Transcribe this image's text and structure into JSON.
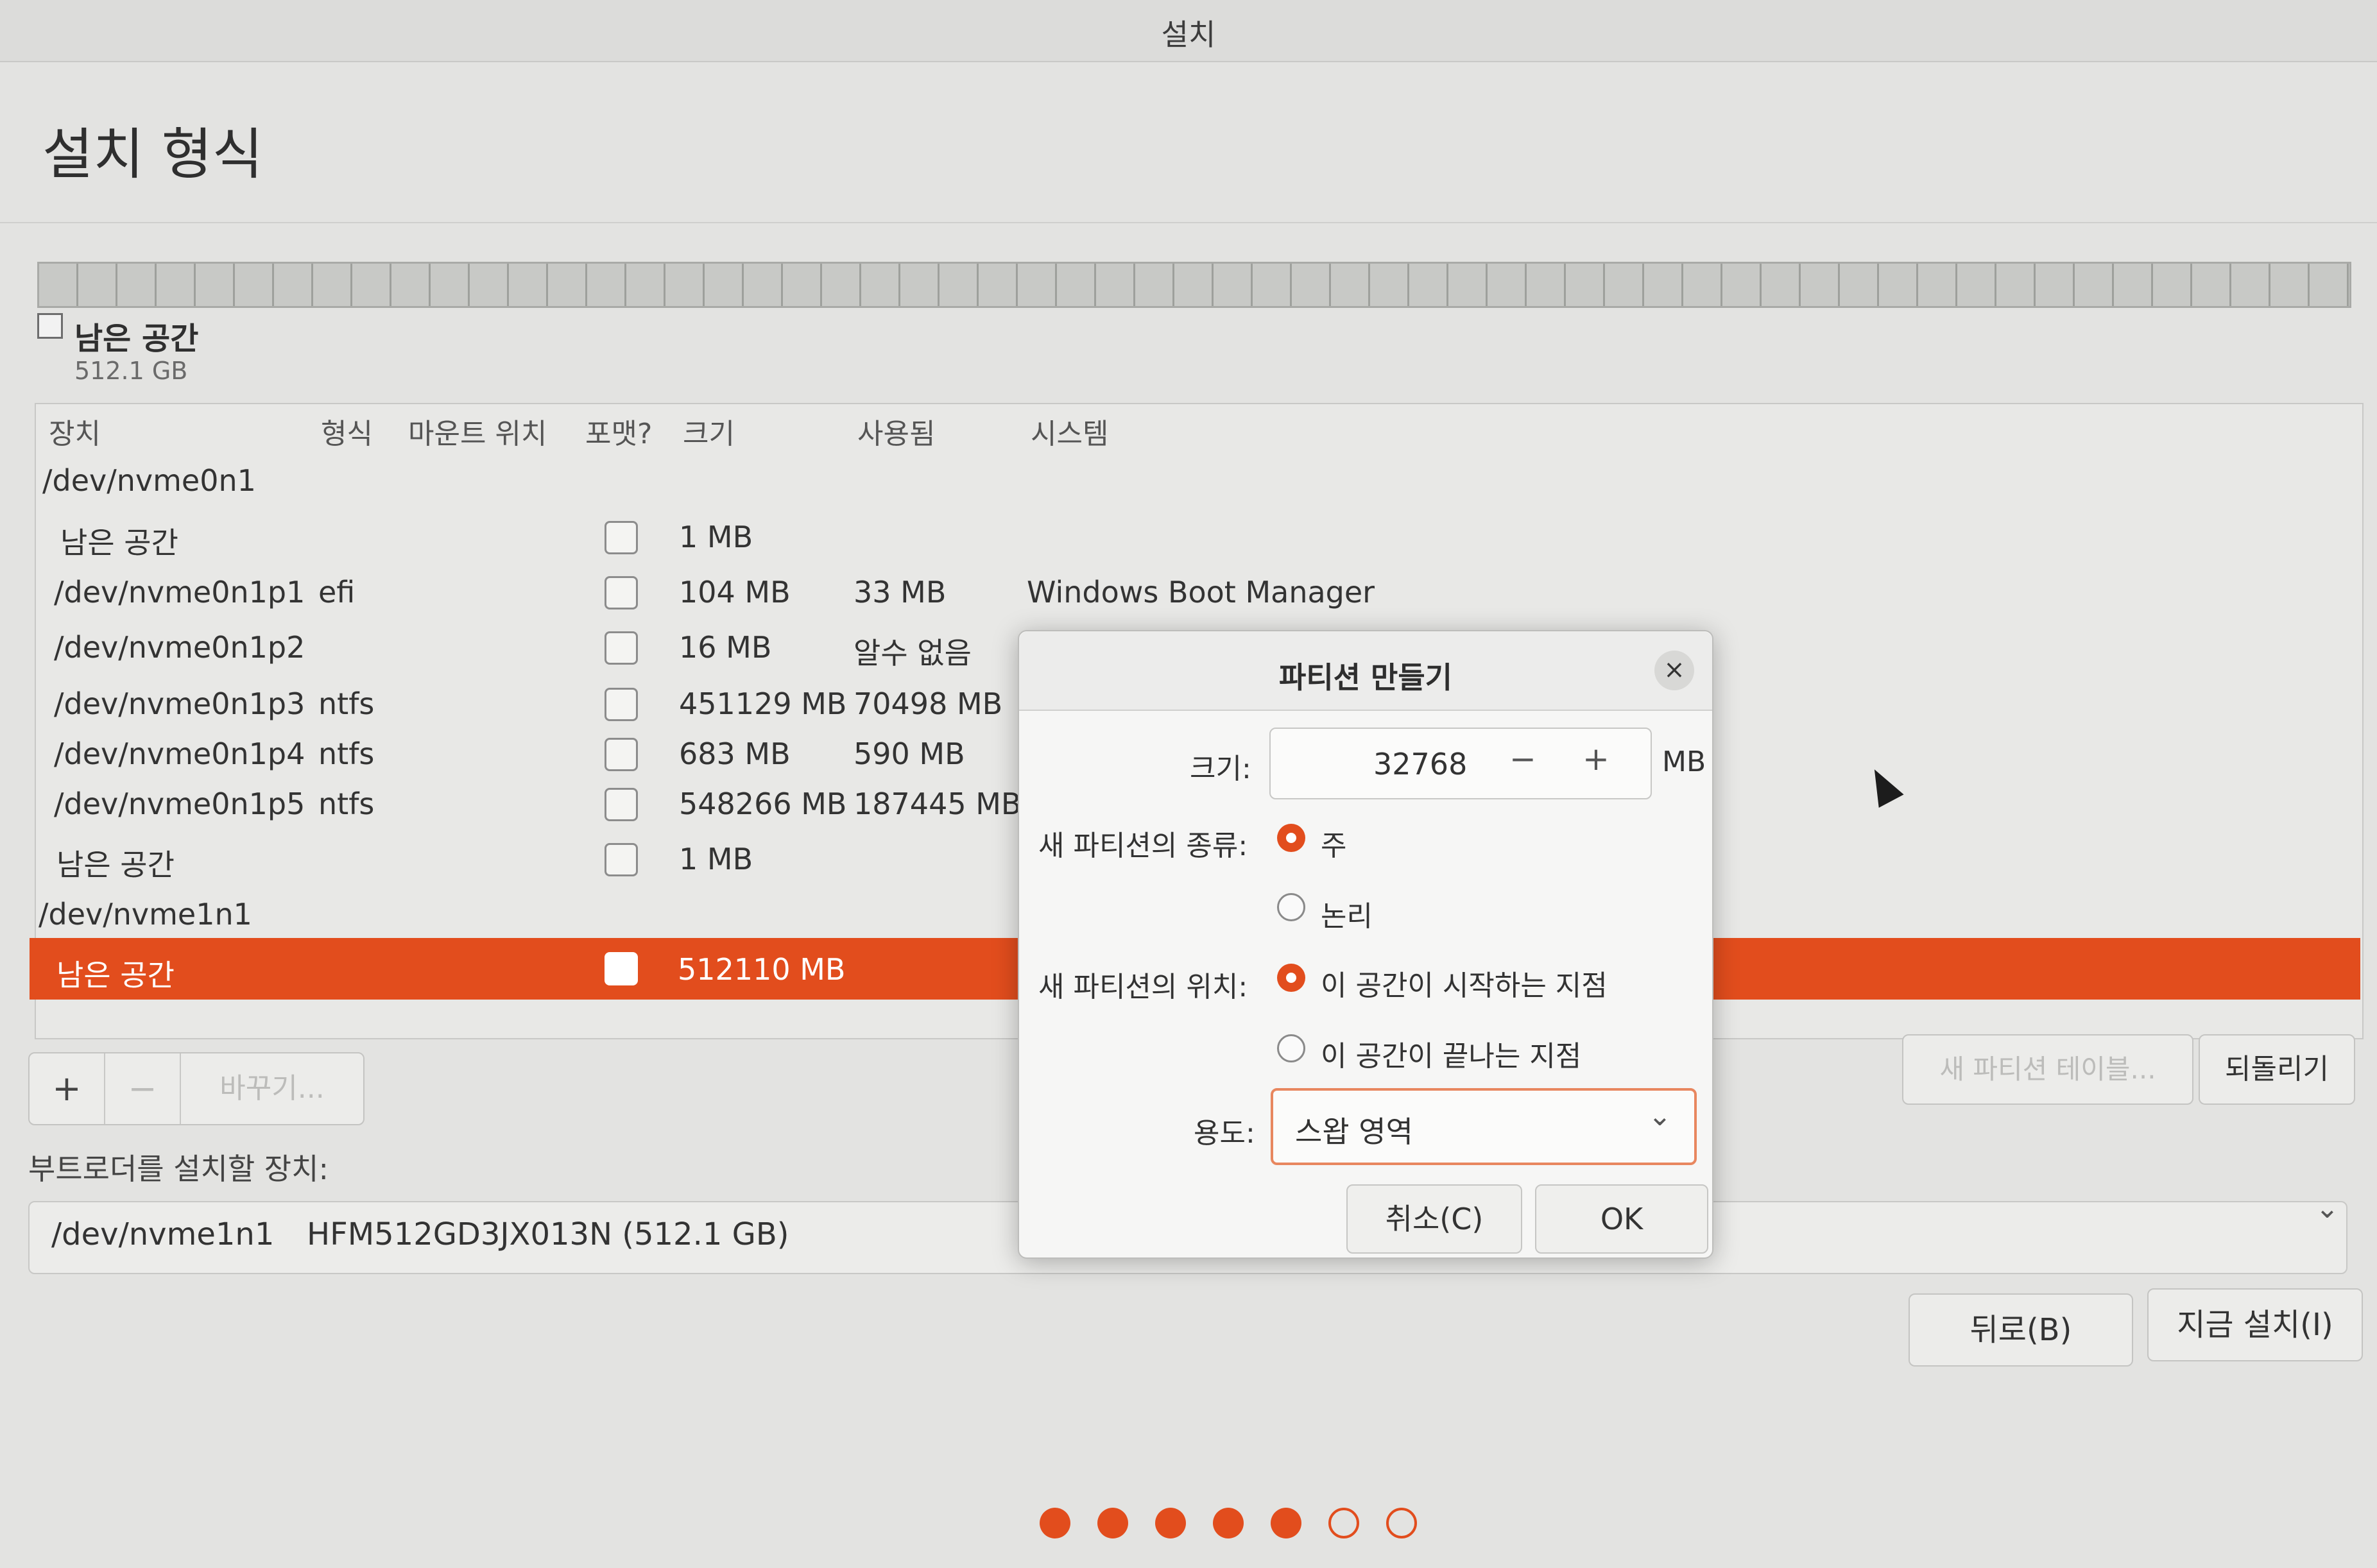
{
  "window": {
    "title": "설치"
  },
  "page": {
    "title": "설치 형식"
  },
  "legend": {
    "name": "남은 공간",
    "size": "512.1 GB"
  },
  "table": {
    "headers": [
      "장치",
      "형식",
      "마운트 위치",
      "포맷?",
      "크기",
      "사용됨",
      "시스템"
    ],
    "rows": [
      {
        "device": "/dev/nvme0n1",
        "type": "",
        "size": "",
        "used": "",
        "system": ""
      },
      {
        "device": "남은 공간",
        "type": "",
        "size": "1 MB",
        "used": "",
        "system": ""
      },
      {
        "device": "/dev/nvme0n1p1",
        "type": "efi",
        "size": "104 MB",
        "used": "33 MB",
        "system": "Windows Boot Manager"
      },
      {
        "device": "/dev/nvme0n1p2",
        "type": "",
        "size": "16 MB",
        "used": "알수 없음",
        "system": ""
      },
      {
        "device": "/dev/nvme0n1p3",
        "type": "ntfs",
        "size": "451129 MB",
        "used": "70498 MB",
        "system": ""
      },
      {
        "device": "/dev/nvme0n1p4",
        "type": "ntfs",
        "size": "683 MB",
        "used": "590 MB",
        "system": ""
      },
      {
        "device": "/dev/nvme0n1p5",
        "type": "ntfs",
        "size": "548266 MB",
        "used": "187445 MB",
        "system": ""
      },
      {
        "device": "남은 공간",
        "type": "",
        "size": "1 MB",
        "used": "",
        "system": ""
      },
      {
        "device": "/dev/nvme1n1",
        "type": "",
        "size": "",
        "used": "",
        "system": ""
      },
      {
        "device": "남은 공간",
        "type": "",
        "size": "512110 MB",
        "used": "",
        "system": ""
      }
    ]
  },
  "toolbar": {
    "add": "+",
    "remove": "−",
    "change": "바꾸기...",
    "new_table": "새 파티션 테이블...",
    "revert": "되돌리기"
  },
  "bootloader": {
    "label": "부트로더를 설치할 장치:",
    "device": "/dev/nvme1n1",
    "model": "HFM512GD3JX013N (512.1 GB)"
  },
  "nav": {
    "back": "뒤로(B)",
    "install": "지금 설치(I)"
  },
  "progress": {
    "total_steps": 7,
    "completed_steps": 5
  },
  "dialog": {
    "title": "파티션 만들기",
    "close_icon": "×",
    "size_label": "크기:",
    "size_value": "32768",
    "size_unit": "MB",
    "minus": "−",
    "plus": "+",
    "type_label": "새 파티션의 종류:",
    "type_primary": "주",
    "type_logical": "논리",
    "location_label": "새 파티션의 위치:",
    "location_start": "이 공간이 시작하는 지점",
    "location_end": "이 공간이 끝나는 지점",
    "use_label": "용도:",
    "use_value": "스왑 영역",
    "cancel": "취소(C)",
    "ok": "OK"
  },
  "colors": {
    "accent": "#e24d1d",
    "background": "#e3e3e1"
  }
}
